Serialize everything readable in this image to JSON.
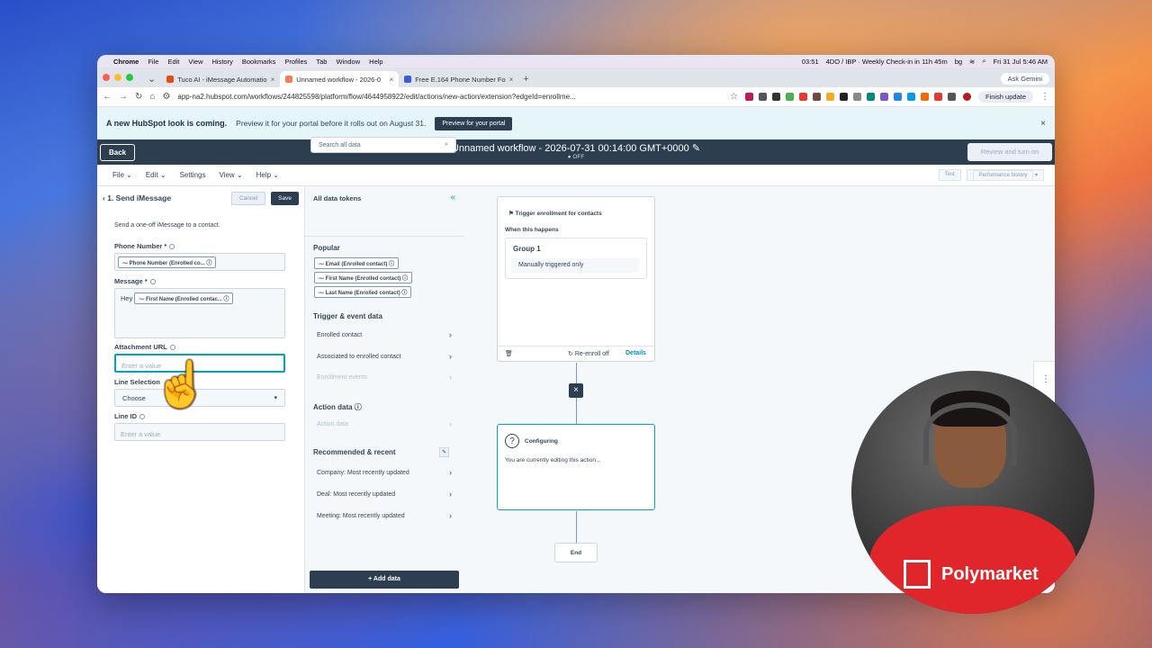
{
  "menubar": {
    "app": "Chrome",
    "items": [
      "File",
      "Edit",
      "View",
      "History",
      "Bookmarks",
      "Profiles",
      "Tab",
      "Window",
      "Help"
    ],
    "timer": "03:51",
    "meeting": "4DO / IBP · Weekly Check-in in 11h 45m",
    "lang": "bg",
    "clock": "Fri 31 Jul 5:46 AM"
  },
  "tabs": [
    {
      "label": "Tuco AI - iMessage Automatio",
      "color": "#e64a19"
    },
    {
      "label": "Unnamed workflow - 2026-0",
      "color": "#ff7a59"
    },
    {
      "label": "Free E.164 Phone Number Fo",
      "color": "#3b5bdb"
    }
  ],
  "ask_gemini": "Ask Gemini",
  "url": "app-na2.hubspot.com/workflows/244825598/platform/flow/4644958922/edit/actions/new-action/extension?edgeId=enrollme...",
  "finish_update": "Finish update",
  "banner": {
    "title": "A new HubSpot look is coming.",
    "text": "Preview it for your portal before it rolls out on August 31.",
    "button": "Preview for your portal"
  },
  "header": {
    "back": "Back",
    "title": "Unnamed workflow - 2026-07-31 00:14:00 GMT+0000",
    "status": "OFF",
    "review": "Review and turn on"
  },
  "submenu": {
    "items": [
      "File",
      "Edit",
      "Settings",
      "View",
      "Help"
    ],
    "test": "Test",
    "perf": "Performance history"
  },
  "action_panel": {
    "title": "1. Send iMessage",
    "cancel": "Cancel",
    "save": "Save",
    "description": "Send a one-off iMessage to a contact.",
    "phone_label": "Phone Number *",
    "phone_token": "Phone Number (Enrolled co...",
    "message_label": "Message *",
    "message_prefix": "Hey",
    "message_token": "First Name (Enrolled contac...",
    "attachment_label": "Attachment URL",
    "attachment_placeholder": "Enter a value",
    "line_selection_label": "Line Selection",
    "line_selection_value": "Choose",
    "line_id_label": "Line ID",
    "line_id_placeholder": "Enter a value"
  },
  "tokens_panel": {
    "title": "All data tokens",
    "search_placeholder": "Search all data",
    "popular_title": "Popular",
    "popular": [
      "Email (Enrolled contact)",
      "First Name (Enrolled contact)",
      "Last Name (Enrolled contact)"
    ],
    "trigger_title": "Trigger & event data",
    "trigger_items": [
      "Enrolled contact",
      "Associated to enrolled contact",
      "Enrollment events"
    ],
    "action_title": "Action data",
    "action_items": [
      "Action data"
    ],
    "recent_title": "Recommended & recent",
    "recent_items": [
      "Company: Most recently updated",
      "Deal: Most recently updated",
      "Meeting: Most recently updated"
    ],
    "add_data": "+ Add data"
  },
  "canvas": {
    "trigger_title": "Trigger enrollment for contacts",
    "when": "When this happens",
    "group": "Group 1",
    "group_text": "Manually triggered only",
    "reenroll": "Re-enroll off",
    "details": "Details",
    "config_title": "Configuring",
    "config_text": "You are currently editing this action...",
    "end": "End"
  },
  "webcam": {
    "shirt_text": "Polymarket"
  }
}
